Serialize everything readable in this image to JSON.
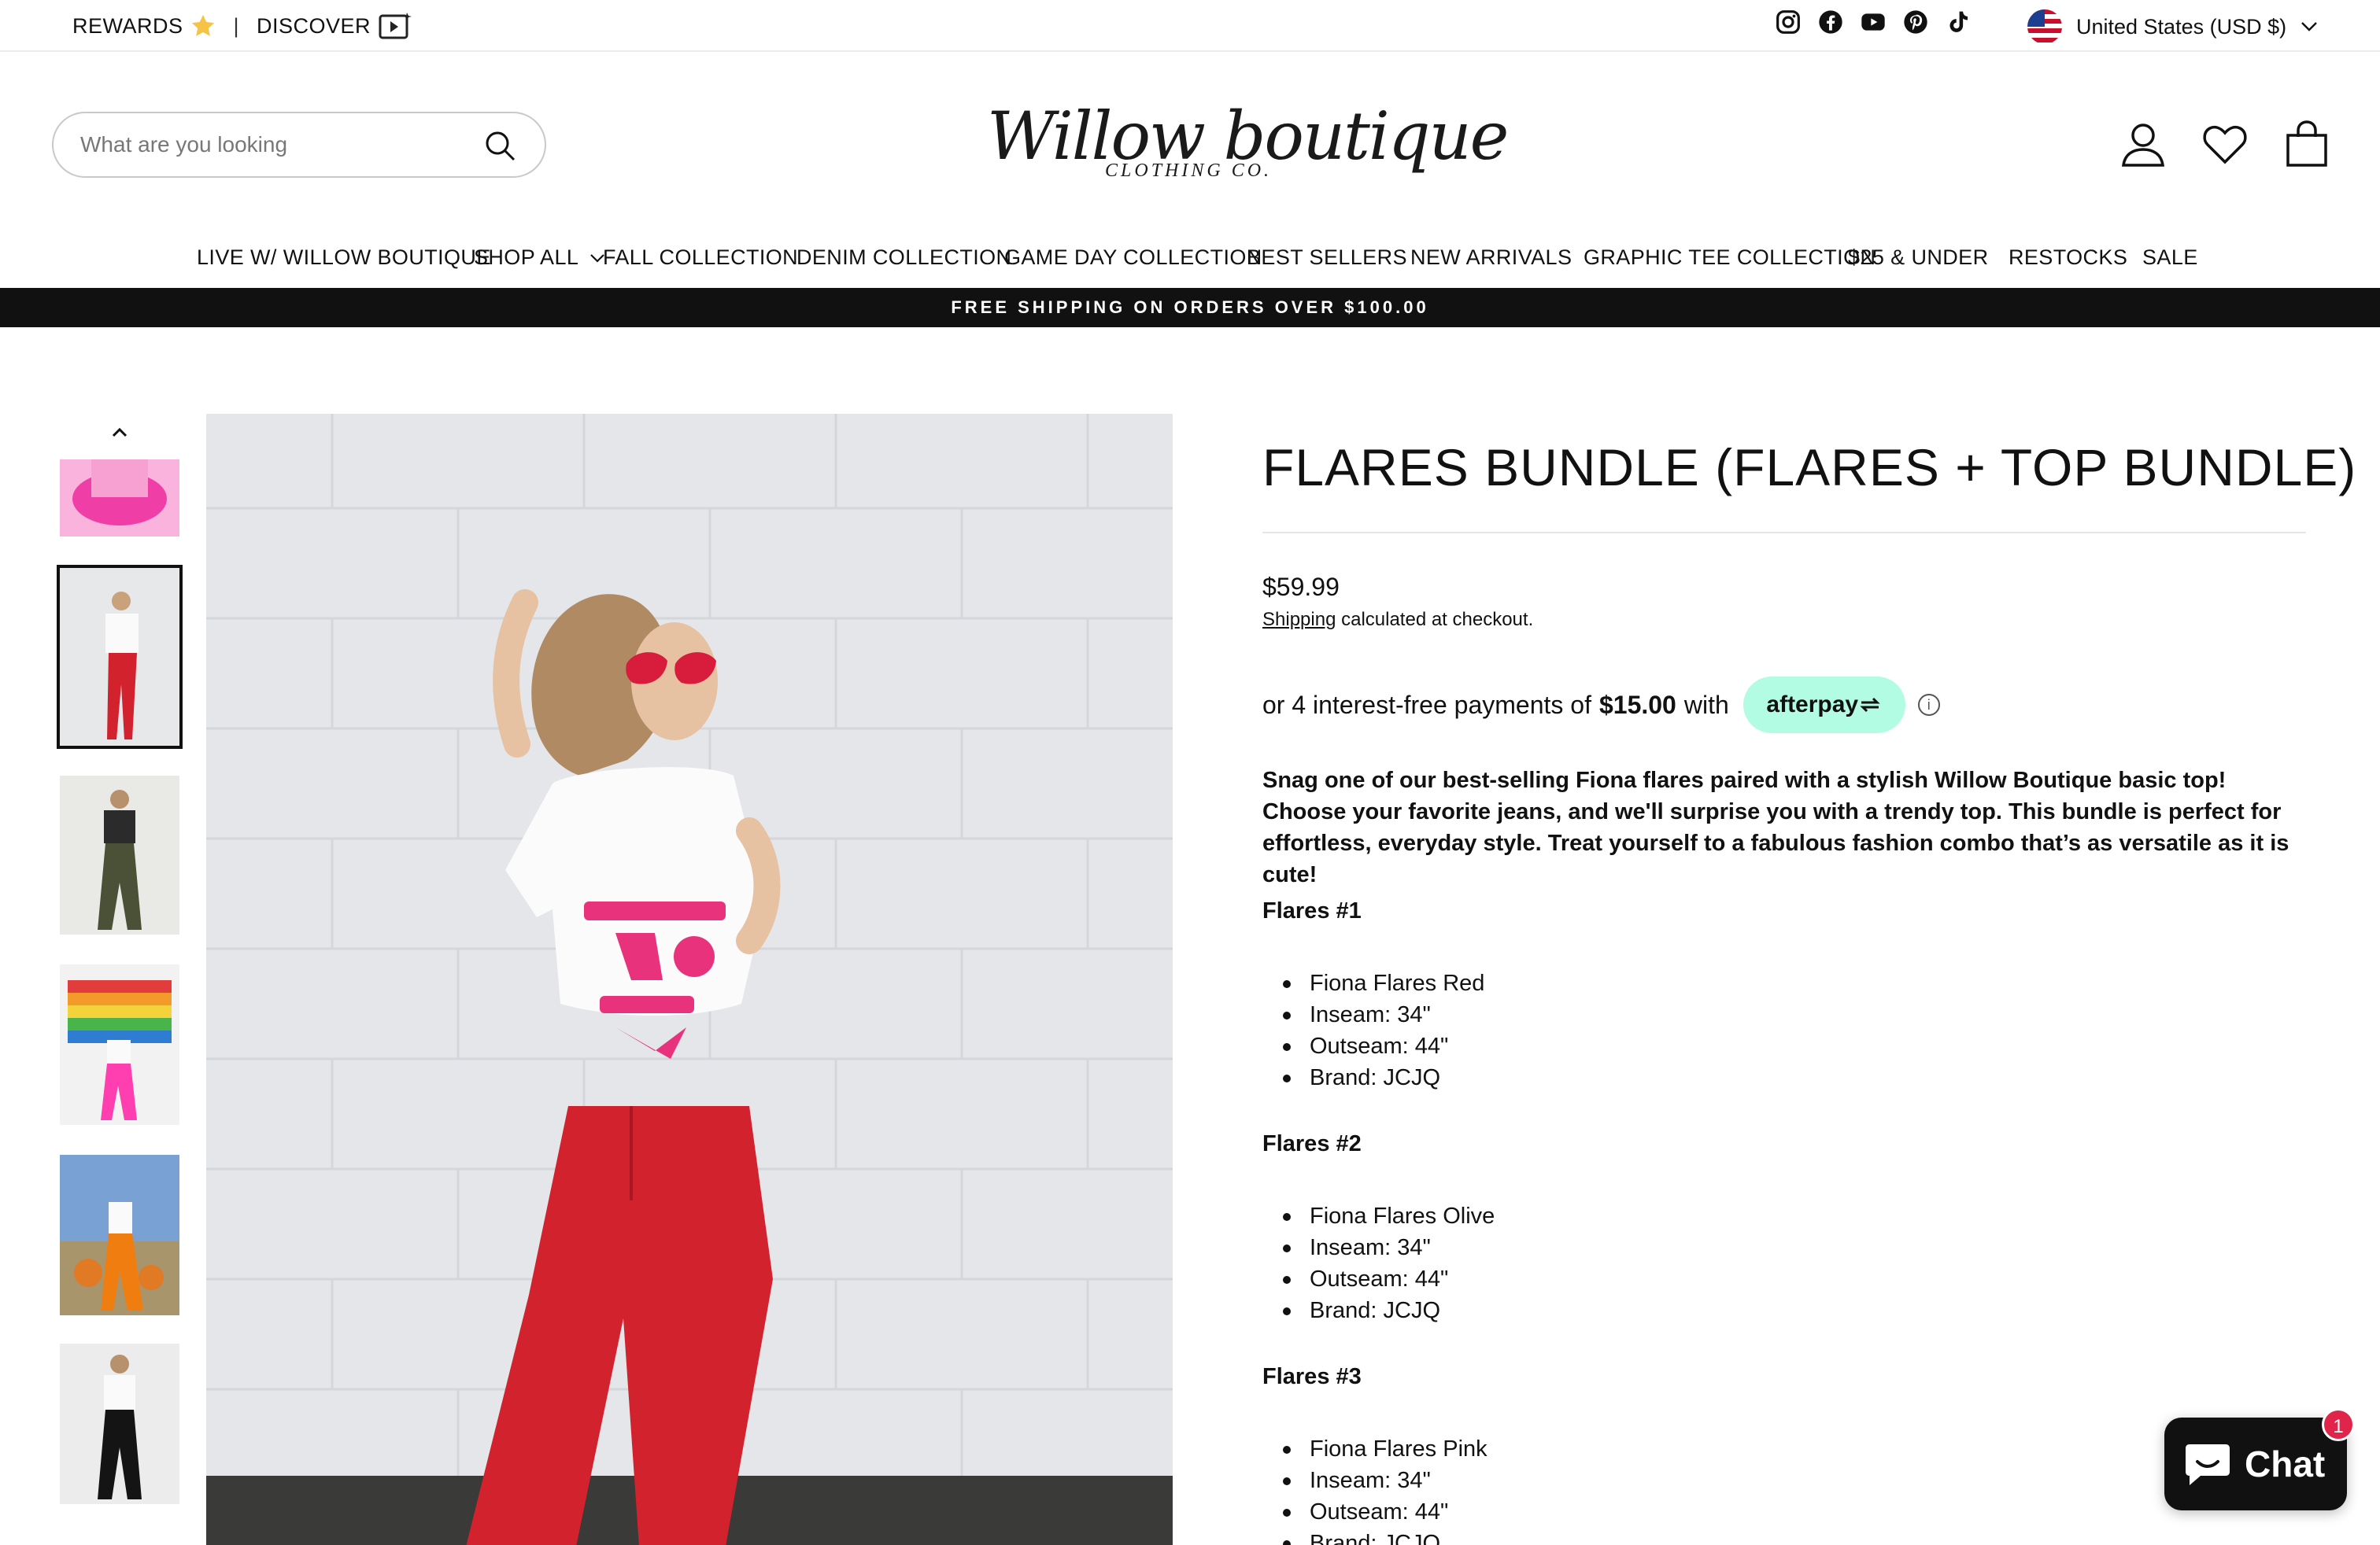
{
  "utility": {
    "rewards": "REWARDS",
    "discover": "DISCOVER",
    "separator": "|",
    "country": "United States (USD $)",
    "social_icons": [
      "instagram-icon",
      "facebook-icon",
      "youtube-icon",
      "pinterest-icon",
      "tiktok-icon"
    ]
  },
  "search": {
    "placeholder": "What are you looking"
  },
  "logo": {
    "script": "Willow boutique",
    "sub": "CLOTHING CO."
  },
  "nav": [
    "LIVE W/ WILLOW BOUTIQUE",
    "SHOP ALL",
    "FALL COLLECTION",
    "DENIM COLLECTION",
    "GAME DAY COLLECTION",
    "BEST SELLERS",
    "NEW ARRIVALS",
    "GRAPHIC TEE COLLECTION",
    "$25 & UNDER",
    "RESTOCKS",
    "SALE"
  ],
  "promo": "FREE SHIPPING ON ORDERS OVER $100.00",
  "product": {
    "title": "FLARES BUNDLE (FLARES + TOP BUNDLE)",
    "price": "$59.99",
    "shipping_link": "Shipping",
    "shipping_text": " calculated at checkout.",
    "afterpay_prefix": "or 4 interest-free payments of",
    "afterpay_amount": "$15.00",
    "afterpay_with": "with",
    "afterpay_brand": "afterpay",
    "description": "Snag one of our best-selling Fiona flares paired with a stylish Willow Boutique basic top! Choose your favorite jeans, and we'll surprise you with a trendy top. This bundle is perfect for effortless, everyday style. Treat yourself to a fabulous fashion combo that’s as versatile as it is cute!",
    "sections": [
      {
        "heading": "Flares #1",
        "items": [
          "Fiona Flares Red",
          "Inseam: 34\"",
          "Outseam: 44\"",
          "Brand: JCJQ"
        ]
      },
      {
        "heading": "Flares #2",
        "items": [
          "Fiona Flares Olive",
          "Inseam: 34\"",
          "Outseam: 44\"",
          "Brand: JCJQ"
        ]
      },
      {
        "heading": "Flares #3",
        "items": [
          "Fiona Flares Pink",
          "Inseam: 34\"",
          "Outseam: 44\"",
          "Brand: JCJQ"
        ]
      }
    ]
  },
  "chat": {
    "label": "Chat",
    "badge": "1"
  },
  "colors": {
    "afterpay_mint": "#b2fce4",
    "promo_bar": "#111111",
    "chat_badge": "#e0244a",
    "pants_red": "#d2222d"
  }
}
